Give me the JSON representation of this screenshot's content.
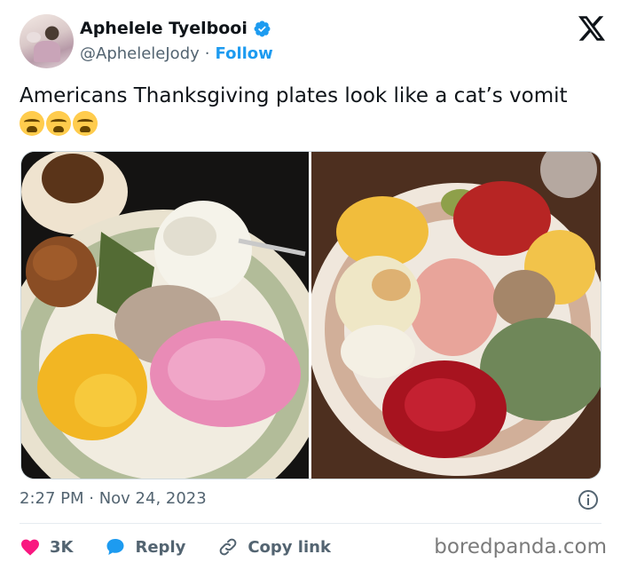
{
  "author": {
    "display_name": "Aphelele Tyelbooi",
    "handle": "@ApheleleJody",
    "separator": "·",
    "follow_label": "Follow",
    "verified": true
  },
  "tweet": {
    "text": "Americans Thanksgiving plates look like a cat’s vomit",
    "emojis": [
      "loudly-crying-face",
      "loudly-crying-face",
      "loudly-crying-face"
    ]
  },
  "meta": {
    "timestamp": "2:27 PM · Nov 24, 2023"
  },
  "actions": {
    "like_count": "3K",
    "reply_label": "Reply",
    "copy_link_label": "Copy link"
  },
  "watermark": "boredpanda.com",
  "colors": {
    "accent": "#1d9bf0",
    "like": "#f91880",
    "text": "#0f1419",
    "muted": "#536471"
  }
}
